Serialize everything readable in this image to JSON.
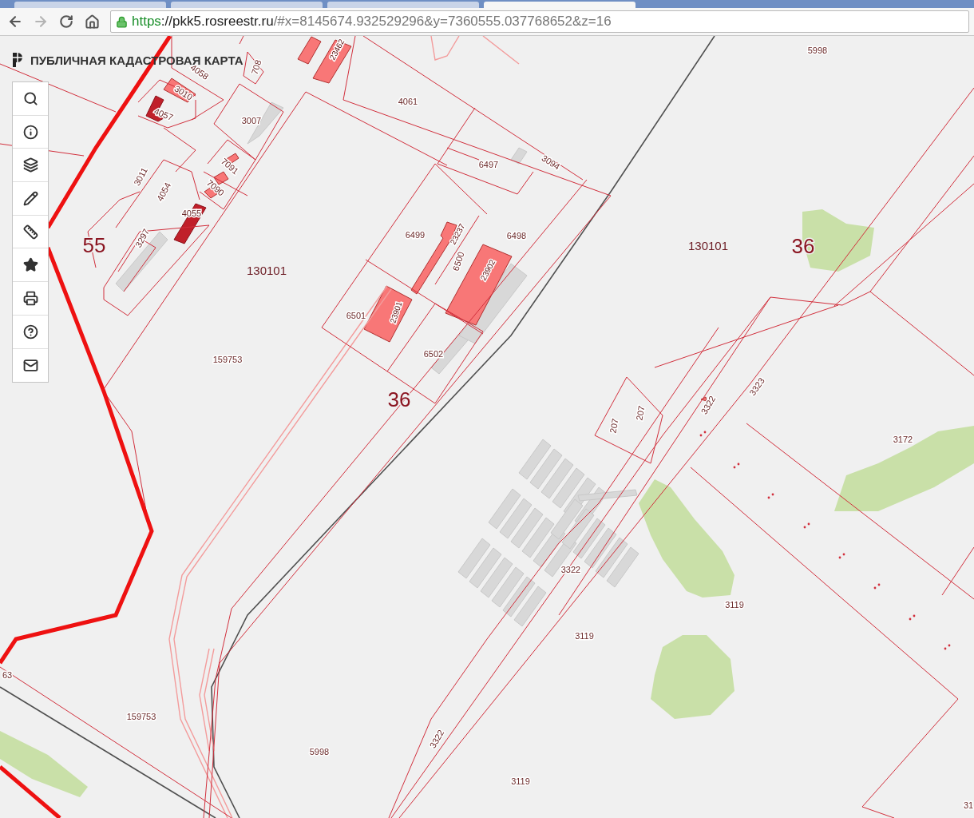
{
  "browser": {
    "tabs": [
      {
        "selected": false
      },
      {
        "selected": false
      },
      {
        "selected": false
      },
      {
        "selected": true
      }
    ],
    "nav": [
      {
        "kind": "back",
        "disabled": false
      },
      {
        "kind": "forward",
        "disabled": true
      },
      {
        "kind": "reload",
        "disabled": false
      },
      {
        "kind": "home",
        "disabled": false
      }
    ],
    "url": {
      "scheme": "https",
      "host": "://pkk5.rosreestr.ru",
      "path": "/#x=8145674.932529296&y=7360555.037768652&z=16"
    }
  },
  "map": {
    "title": "ПУБЛИЧНАЯ КАДАСТРОВАЯ КАРТА",
    "tools": [
      {
        "kind": "search"
      },
      {
        "kind": "info"
      },
      {
        "kind": "layers"
      },
      {
        "kind": "draw"
      },
      {
        "kind": "measure"
      },
      {
        "kind": "favorites"
      },
      {
        "kind": "print"
      },
      {
        "kind": "help"
      },
      {
        "kind": "mail"
      }
    ],
    "labels": [
      {
        "text": "23462",
        "kind": "building"
      },
      {
        "text": "4058",
        "kind": "parcel"
      },
      {
        "text": "708",
        "kind": "parcel"
      },
      {
        "text": "5998",
        "kind": "parcel"
      },
      {
        "text": "3010",
        "kind": "parcel"
      },
      {
        "text": "4061",
        "kind": "parcel"
      },
      {
        "text": "4057",
        "kind": "parcel"
      },
      {
        "text": "3007",
        "kind": "parcel"
      },
      {
        "text": "6497",
        "kind": "parcel"
      },
      {
        "text": "3094",
        "kind": "parcel"
      },
      {
        "text": "7091",
        "kind": "parcel"
      },
      {
        "text": "3011",
        "kind": "parcel"
      },
      {
        "text": "7090",
        "kind": "parcel"
      },
      {
        "text": "4054",
        "kind": "parcel"
      },
      {
        "text": "4055",
        "kind": "parcel"
      },
      {
        "text": "6499",
        "kind": "parcel"
      },
      {
        "text": "23237",
        "kind": "building"
      },
      {
        "text": "6498",
        "kind": "parcel"
      },
      {
        "text": "3297",
        "kind": "parcel"
      },
      {
        "text": "55",
        "kind": "district"
      },
      {
        "text": "130101",
        "kind": "quarter"
      },
      {
        "text": "130101",
        "kind": "quarter"
      },
      {
        "text": "36",
        "kind": "district"
      },
      {
        "text": "6500",
        "kind": "parcel"
      },
      {
        "text": "23902",
        "kind": "building"
      },
      {
        "text": "6501",
        "kind": "parcel"
      },
      {
        "text": "23901",
        "kind": "building"
      },
      {
        "text": "6502",
        "kind": "parcel"
      },
      {
        "text": "159753",
        "kind": "parcel"
      },
      {
        "text": "36",
        "kind": "district"
      },
      {
        "text": "3323",
        "kind": "parcel"
      },
      {
        "text": "3322",
        "kind": "parcel"
      },
      {
        "text": "207",
        "kind": "parcel"
      },
      {
        "text": "207",
        "kind": "parcel"
      },
      {
        "text": "3172",
        "kind": "parcel"
      },
      {
        "text": "3322",
        "kind": "parcel"
      },
      {
        "text": "3119",
        "kind": "parcel"
      },
      {
        "text": "3119",
        "kind": "parcel"
      },
      {
        "text": "63",
        "kind": "parcel"
      },
      {
        "text": "159753",
        "kind": "parcel"
      },
      {
        "text": "3322",
        "kind": "parcel"
      },
      {
        "text": "5998",
        "kind": "parcel"
      },
      {
        "text": "3119",
        "kind": "parcel"
      },
      {
        "text": "31",
        "kind": "parcel"
      }
    ]
  }
}
